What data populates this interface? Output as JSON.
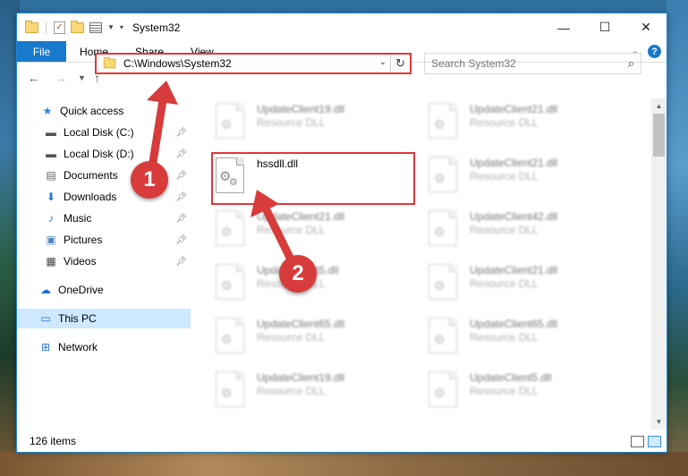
{
  "titlebar": {
    "title": "System32",
    "minimize": "—",
    "maximize": "☐",
    "close": "✕"
  },
  "ribbon": {
    "file": "File",
    "tabs": [
      "Home",
      "Share",
      "View"
    ],
    "help": "?"
  },
  "address": {
    "path": "C:\\Windows\\System32",
    "search_placeholder": "Search System32"
  },
  "nav": [
    {
      "label": "Quick access",
      "icon": "star-icon",
      "pinned": false
    },
    {
      "label": "Local Disk (C:)",
      "icon": "drive-icon",
      "pinned": true
    },
    {
      "label": "Local Disk (D:)",
      "icon": "drive-icon",
      "pinned": true
    },
    {
      "label": "Documents",
      "icon": "documents-icon",
      "pinned": true
    },
    {
      "label": "Downloads",
      "icon": "downloads-icon",
      "pinned": true
    },
    {
      "label": "Music",
      "icon": "music-icon",
      "pinned": true
    },
    {
      "label": "Pictures",
      "icon": "pictures-icon",
      "pinned": true
    },
    {
      "label": "Videos",
      "icon": "videos-icon",
      "pinned": true
    },
    {
      "label": "OneDrive",
      "icon": "onedrive-icon",
      "pinned": false
    },
    {
      "label": "This PC",
      "icon": "pc-icon",
      "pinned": false,
      "selected": true
    },
    {
      "label": "Network",
      "icon": "network-icon",
      "pinned": false
    }
  ],
  "files_left": [
    {
      "name": "UpdateClient19.dll",
      "type": "Resource DLL"
    },
    {
      "name": "hssdll.dll",
      "type": ""
    },
    {
      "name": "UpdateClient21.dll",
      "type": "Resource DLL"
    },
    {
      "name": "UpdateClient5.dll",
      "type": "Resource DLL"
    },
    {
      "name": "UpdateClient65.dll",
      "type": "Resource DLL"
    },
    {
      "name": "UpdateClient19.dll",
      "type": "Resource DLL"
    }
  ],
  "files_right": [
    {
      "name": "UpdateClient21.dll",
      "type": "Resource DLL"
    },
    {
      "name": "UpdateClient21.dll",
      "type": "Resource DLL"
    },
    {
      "name": "UpdateClient42.dll",
      "type": "Resource DLL"
    },
    {
      "name": "UpdateClient21.dll",
      "type": "Resource DLL"
    },
    {
      "name": "UpdateClient65.dll",
      "type": "Resource DLL"
    },
    {
      "name": "UpdateClient5.dll",
      "type": "Resource DLL"
    }
  ],
  "status": {
    "count": "126 items"
  },
  "annotations": {
    "step1": "1",
    "step2": "2"
  },
  "colors": {
    "accent": "#1979ca",
    "annotation": "#d83b3b"
  }
}
